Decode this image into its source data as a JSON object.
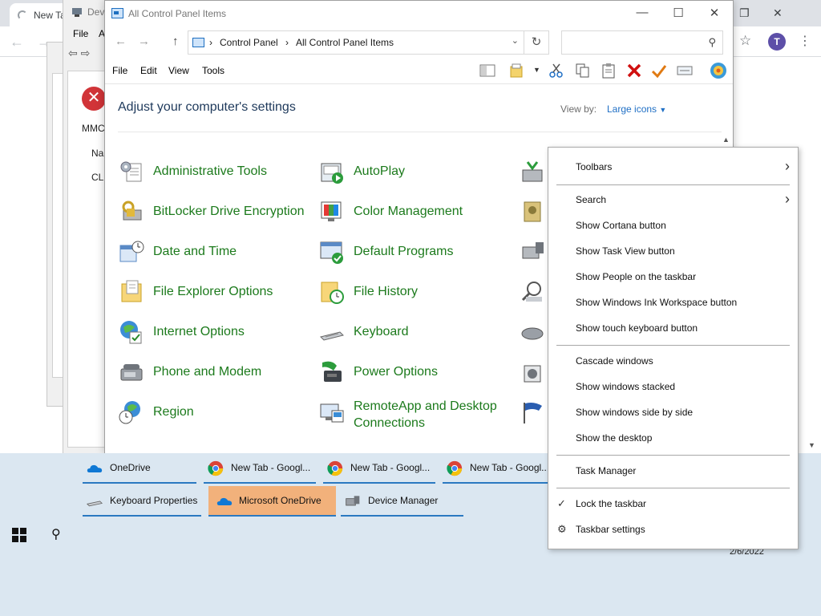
{
  "chrome": {
    "tab_label": "New Tab",
    "second_tab_partial": "Dev",
    "avatar_letter": "T"
  },
  "device_manager": {
    "title_partial": "Dev",
    "menu_file": "File",
    "menu_partial": "A"
  },
  "mmc_dialog": {
    "line1": "MMC",
    "line2": "Na",
    "line3": "CL"
  },
  "control_panel": {
    "title": "All Control Panel Items",
    "breadcrumb": [
      "Control Panel",
      "All Control Panel Items"
    ],
    "search_placeholder": "",
    "menu": [
      "File",
      "Edit",
      "View",
      "Tools"
    ],
    "heading": "Adjust your computer's settings",
    "view_by_label": "View by:",
    "view_by_value": "Large icons",
    "items_col1": [
      {
        "label": "Administrative Tools",
        "icon": "admin-tools-icon"
      },
      {
        "label": "BitLocker Drive Encryption",
        "icon": "bitlocker-icon"
      },
      {
        "label": "Date and Time",
        "icon": "date-time-icon"
      },
      {
        "label": "File Explorer Options",
        "icon": "folder-options-icon"
      },
      {
        "label": "Internet Options",
        "icon": "internet-options-icon"
      },
      {
        "label": "Phone and Modem",
        "icon": "phone-modem-icon"
      },
      {
        "label": "Region",
        "icon": "region-icon"
      }
    ],
    "items_col2": [
      {
        "label": "AutoPlay",
        "icon": "autoplay-icon"
      },
      {
        "label": "Color Management",
        "icon": "color-management-icon"
      },
      {
        "label": "Default Programs",
        "icon": "default-programs-icon"
      },
      {
        "label": "File History",
        "icon": "file-history-icon"
      },
      {
        "label": "Keyboard",
        "icon": "keyboard-icon"
      },
      {
        "label": "Power Options",
        "icon": "power-options-icon"
      },
      {
        "label": "RemoteApp and Desktop Connections",
        "icon": "remoteapp-icon"
      }
    ]
  },
  "taskbar": {
    "row1": [
      {
        "label": "OneDrive",
        "icon": "onedrive-icon"
      },
      {
        "label": "New Tab - Googl...",
        "icon": "chrome-icon"
      },
      {
        "label": "New Tab - Googl...",
        "icon": "chrome-icon"
      },
      {
        "label": "New Tab - Googl...",
        "icon": "chrome-icon"
      }
    ],
    "row2": [
      {
        "label": "Keyboard Properties",
        "icon": "keyboard-icon"
      },
      {
        "label": "Microsoft OneDrive",
        "icon": "onedrive-icon"
      },
      {
        "label": "Device Manager",
        "icon": "device-manager-icon"
      }
    ],
    "date": "2/6/2022"
  },
  "context_menu": {
    "toolbars": "Toolbars",
    "search": "Search",
    "show_cortana": "Show Cortana button",
    "show_task_view": "Show Task View button",
    "show_people": "Show People on the taskbar",
    "show_ink": "Show Windows Ink Workspace button",
    "show_touch_keyboard": "Show touch keyboard button",
    "cascade": "Cascade windows",
    "stacked": "Show windows stacked",
    "side_by_side": "Show windows side by side",
    "show_desktop": "Show the desktop",
    "task_manager": "Task Manager",
    "lock_taskbar": "Lock the taskbar",
    "lock_taskbar_checked": true,
    "taskbar_settings": "Taskbar settings"
  }
}
